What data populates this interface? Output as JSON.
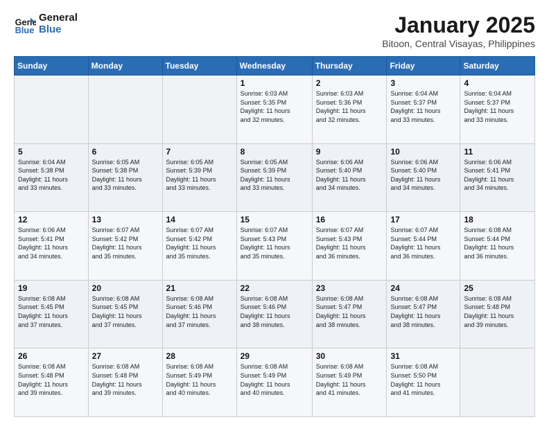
{
  "header": {
    "logo_line1": "General",
    "logo_line2": "Blue",
    "title": "January 2025",
    "subtitle": "Bitoon, Central Visayas, Philippines"
  },
  "weekdays": [
    "Sunday",
    "Monday",
    "Tuesday",
    "Wednesday",
    "Thursday",
    "Friday",
    "Saturday"
  ],
  "weeks": [
    [
      {
        "day": "",
        "info": ""
      },
      {
        "day": "",
        "info": ""
      },
      {
        "day": "",
        "info": ""
      },
      {
        "day": "1",
        "info": "Sunrise: 6:03 AM\nSunset: 5:35 PM\nDaylight: 11 hours\nand 32 minutes."
      },
      {
        "day": "2",
        "info": "Sunrise: 6:03 AM\nSunset: 5:36 PM\nDaylight: 11 hours\nand 32 minutes."
      },
      {
        "day": "3",
        "info": "Sunrise: 6:04 AM\nSunset: 5:37 PM\nDaylight: 11 hours\nand 33 minutes."
      },
      {
        "day": "4",
        "info": "Sunrise: 6:04 AM\nSunset: 5:37 PM\nDaylight: 11 hours\nand 33 minutes."
      }
    ],
    [
      {
        "day": "5",
        "info": "Sunrise: 6:04 AM\nSunset: 5:38 PM\nDaylight: 11 hours\nand 33 minutes."
      },
      {
        "day": "6",
        "info": "Sunrise: 6:05 AM\nSunset: 5:38 PM\nDaylight: 11 hours\nand 33 minutes."
      },
      {
        "day": "7",
        "info": "Sunrise: 6:05 AM\nSunset: 5:39 PM\nDaylight: 11 hours\nand 33 minutes."
      },
      {
        "day": "8",
        "info": "Sunrise: 6:05 AM\nSunset: 5:39 PM\nDaylight: 11 hours\nand 33 minutes."
      },
      {
        "day": "9",
        "info": "Sunrise: 6:06 AM\nSunset: 5:40 PM\nDaylight: 11 hours\nand 34 minutes."
      },
      {
        "day": "10",
        "info": "Sunrise: 6:06 AM\nSunset: 5:40 PM\nDaylight: 11 hours\nand 34 minutes."
      },
      {
        "day": "11",
        "info": "Sunrise: 6:06 AM\nSunset: 5:41 PM\nDaylight: 11 hours\nand 34 minutes."
      }
    ],
    [
      {
        "day": "12",
        "info": "Sunrise: 6:06 AM\nSunset: 5:41 PM\nDaylight: 11 hours\nand 34 minutes."
      },
      {
        "day": "13",
        "info": "Sunrise: 6:07 AM\nSunset: 5:42 PM\nDaylight: 11 hours\nand 35 minutes."
      },
      {
        "day": "14",
        "info": "Sunrise: 6:07 AM\nSunset: 5:42 PM\nDaylight: 11 hours\nand 35 minutes."
      },
      {
        "day": "15",
        "info": "Sunrise: 6:07 AM\nSunset: 5:43 PM\nDaylight: 11 hours\nand 35 minutes."
      },
      {
        "day": "16",
        "info": "Sunrise: 6:07 AM\nSunset: 5:43 PM\nDaylight: 11 hours\nand 36 minutes."
      },
      {
        "day": "17",
        "info": "Sunrise: 6:07 AM\nSunset: 5:44 PM\nDaylight: 11 hours\nand 36 minutes."
      },
      {
        "day": "18",
        "info": "Sunrise: 6:08 AM\nSunset: 5:44 PM\nDaylight: 11 hours\nand 36 minutes."
      }
    ],
    [
      {
        "day": "19",
        "info": "Sunrise: 6:08 AM\nSunset: 5:45 PM\nDaylight: 11 hours\nand 37 minutes."
      },
      {
        "day": "20",
        "info": "Sunrise: 6:08 AM\nSunset: 5:45 PM\nDaylight: 11 hours\nand 37 minutes."
      },
      {
        "day": "21",
        "info": "Sunrise: 6:08 AM\nSunset: 5:46 PM\nDaylight: 11 hours\nand 37 minutes."
      },
      {
        "day": "22",
        "info": "Sunrise: 6:08 AM\nSunset: 5:46 PM\nDaylight: 11 hours\nand 38 minutes."
      },
      {
        "day": "23",
        "info": "Sunrise: 6:08 AM\nSunset: 5:47 PM\nDaylight: 11 hours\nand 38 minutes."
      },
      {
        "day": "24",
        "info": "Sunrise: 6:08 AM\nSunset: 5:47 PM\nDaylight: 11 hours\nand 38 minutes."
      },
      {
        "day": "25",
        "info": "Sunrise: 6:08 AM\nSunset: 5:48 PM\nDaylight: 11 hours\nand 39 minutes."
      }
    ],
    [
      {
        "day": "26",
        "info": "Sunrise: 6:08 AM\nSunset: 5:48 PM\nDaylight: 11 hours\nand 39 minutes."
      },
      {
        "day": "27",
        "info": "Sunrise: 6:08 AM\nSunset: 5:48 PM\nDaylight: 11 hours\nand 39 minutes."
      },
      {
        "day": "28",
        "info": "Sunrise: 6:08 AM\nSunset: 5:49 PM\nDaylight: 11 hours\nand 40 minutes."
      },
      {
        "day": "29",
        "info": "Sunrise: 6:08 AM\nSunset: 5:49 PM\nDaylight: 11 hours\nand 40 minutes."
      },
      {
        "day": "30",
        "info": "Sunrise: 6:08 AM\nSunset: 5:49 PM\nDaylight: 11 hours\nand 41 minutes."
      },
      {
        "day": "31",
        "info": "Sunrise: 6:08 AM\nSunset: 5:50 PM\nDaylight: 11 hours\nand 41 minutes."
      },
      {
        "day": "",
        "info": ""
      }
    ]
  ]
}
